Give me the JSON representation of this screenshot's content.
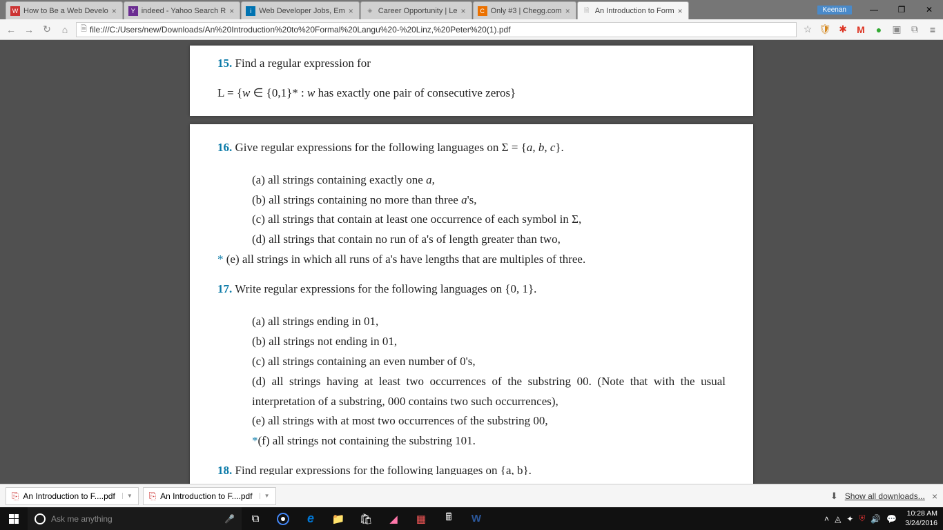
{
  "tabs": [
    {
      "favicon_bg": "#c33",
      "favicon_text": "W",
      "label": "How to Be a Web Develo"
    },
    {
      "favicon_bg": "#6b2c91",
      "favicon_text": "Y",
      "label": "indeed - Yahoo Search R"
    },
    {
      "favicon_bg": "#0073b1",
      "favicon_text": "i",
      "label": "Web Developer Jobs, Em"
    },
    {
      "favicon_bg": "#888",
      "favicon_text": "◈",
      "label": "Career Opportunity | Le"
    },
    {
      "favicon_bg": "#eb7100",
      "favicon_text": "C",
      "label": "Only #3 | Chegg.com"
    },
    {
      "favicon_bg": "#f5f5f5",
      "favicon_text": "🗎",
      "label": "An Introduction to Form",
      "active": true
    }
  ],
  "user_badge": "Keenan",
  "url": "file:///C:/Users/new/Downloads/An%20Introduction%20to%20Formal%20Langu%20-%20Linz,%20Peter%20(1).pdf",
  "doc": {
    "q15": {
      "num": "15.",
      "text": "Find a regular expression for",
      "line2_a": "L = {",
      "line2_b": "w",
      "line2_c": " ∈ {0,1}* : ",
      "line2_d": "w",
      "line2_e": " has exactly one pair of consecutive zeros}"
    },
    "q16": {
      "num": "16.",
      "text": "Give regular expressions for the following languages on Σ = {",
      "sigma": "a, b, c",
      "text2": "}.",
      "a": "(a) all strings containing exactly one ",
      "a_it": "a",
      "a2": ",",
      "b": "(b) all strings containing no more than three ",
      "b_it": "a",
      "b2": "'s,",
      "c": "(c) all strings that contain at least one occurrence of each symbol in Σ,",
      "d": "(d) all strings that contain no run of a's of length greater than two,",
      "e_star": "*",
      "e": " (e) all strings in which all runs of a's have lengths that are multiples of three."
    },
    "q17": {
      "num": "17.",
      "text": "Write regular expressions for the following languages on {0, 1}.",
      "a": "(a) all strings ending in 01,",
      "b": "(b) all strings not ending in 01,",
      "c": "(c) all strings containing an even number of 0's,",
      "d": "(d) all strings having at least two occurrences of the substring 00. (Note that with the usual interpretation of a substring, 000 contains two such occurrences),",
      "e": "(e) all strings with at most two occurrences of the substring 00,",
      "f_star": "*",
      "f": "(f) all strings not containing the substring 101."
    },
    "q18": {
      "num": "18.",
      "text": "Find regular expressions for the following languages on {a, b}."
    }
  },
  "downloads": {
    "item1": "An Introduction to F....pdf",
    "item2": "An Introduction to F....pdf",
    "show_all": "Show all downloads..."
  },
  "taskbar": {
    "cortana": "Ask me anything",
    "time": "10:28 AM",
    "date": "3/24/2016"
  }
}
